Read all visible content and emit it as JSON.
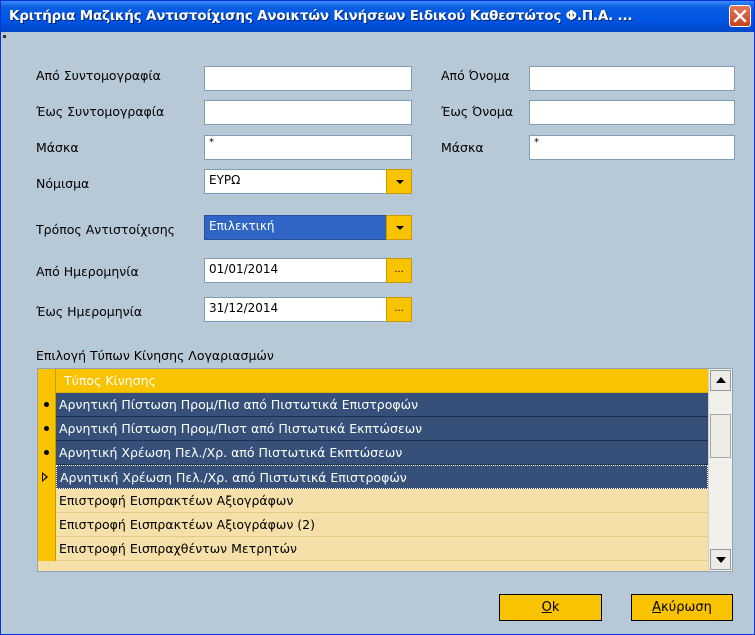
{
  "window": {
    "title": "Κριτήρια Μαζικής Αντιστοίχισης Ανοικτών Κινήσεων Ειδικού Καθεστώτος Φ.Π.Α. ...",
    "close_icon": "close-icon"
  },
  "colors": {
    "background": "#b7c9d6",
    "title_bar": "#0055e5",
    "accent_yellow": "#f9c300",
    "selected_row": "#36507a",
    "unselected_row": "#f4e0a8"
  },
  "left": {
    "from_code_label": "Από Συντομογραφία",
    "from_code_value": "",
    "to_code_label": "Έως Συντομογραφία",
    "to_code_value": "",
    "mask_label": "Μάσκα",
    "mask_value": "*",
    "currency_label": "Νόμισμα",
    "currency_value": "ΕΥΡΩ",
    "match_mode_label": "Τρόπος Αντιστοίχισης",
    "match_mode_value": "Επιλεκτική",
    "from_date_label": "Από Ημερομηνία",
    "from_date_value": "01/01/2014",
    "to_date_label": "Έως Ημερομηνία",
    "to_date_value": "31/12/2014",
    "date_picker_label": "..."
  },
  "right": {
    "from_name_label": "Από Όνομα",
    "from_name_value": "",
    "to_name_label": "Έως Όνομα",
    "to_name_value": "",
    "mask_label": "Μάσκα",
    "mask_value": "*"
  },
  "grid": {
    "section_label": "Επιλογή Τύπων Κίνησης Λογαριασμών",
    "column_header": "Τύπος Κίνησης",
    "rows": [
      {
        "label": "Αρνητική Πίστωση Προμ/Πισ από Πιστωτικά Επιστροφών",
        "selected": true,
        "current": false
      },
      {
        "label": "Αρνητική Πίστωση Προμ/Πιστ από Πιστωτικά Εκπτώσεων",
        "selected": true,
        "current": false
      },
      {
        "label": "Αρνητική Χρέωση Πελ./Χρ. από Πιστωτικά Εκπτώσεων",
        "selected": true,
        "current": false
      },
      {
        "label": "Αρνητική Χρέωση Πελ./Χρ. από Πιστωτικά Επιστροφών",
        "selected": true,
        "current": true
      },
      {
        "label": "Επιστροφή Εισπρακτέων Αξιογράφων",
        "selected": false,
        "current": false
      },
      {
        "label": "Επιστροφή Εισπρακτέων Αξιογράφων (2)",
        "selected": false,
        "current": false
      },
      {
        "label": "Επιστροφή Εισπραχθέντων Μετρητών",
        "selected": false,
        "current": false
      }
    ]
  },
  "buttons": {
    "ok_underlined": "O",
    "ok_rest": "k",
    "cancel_underlined": "Α",
    "cancel_rest": "κύρωση"
  }
}
